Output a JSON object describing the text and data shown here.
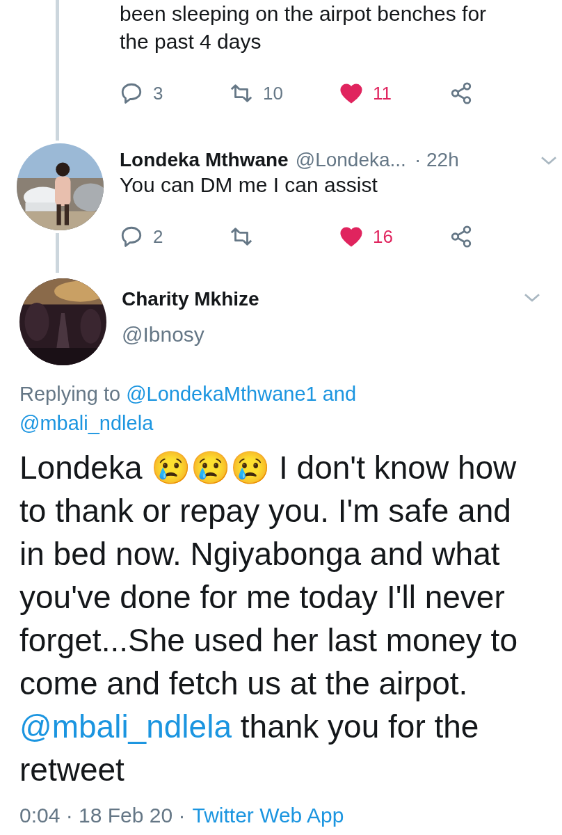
{
  "previous_tweet": {
    "text_lines": [
      "been sleeping on the airpot benches for",
      "the past 4 days"
    ],
    "actions": {
      "replies": "3",
      "retweets": "10",
      "likes": "11",
      "liked": true,
      "retweeted": false
    }
  },
  "reply_tweet": {
    "name": "Londeka Mthwane",
    "handle": "@Londeka...",
    "time": "· 22h",
    "text": "You can DM me I can assist",
    "actions": {
      "replies": "2",
      "likes": "16",
      "liked": true,
      "retweeted": false
    }
  },
  "main_tweet": {
    "name": "Charity Mkhize",
    "handle": "@Ibnosy",
    "replying": [
      {
        "kind": "text",
        "text": "Replying to"
      },
      {
        "kind": "mention",
        "text": "@LondekaMthwane1 and"
      },
      {
        "kind": "mention",
        "text": "@mbali_ndlela"
      }
    ],
    "body": [
      {
        "kind": "text",
        "text": "Londeka 😢😢😢 I don't know how to thank or repay you. I'm safe and in bed now. Ngiyabonga and what you've done for me today I'll never forget...She used her last money to come and fetch us at the airpot."
      },
      {
        "kind": "mention",
        "text": "@mbali_ndlela"
      },
      {
        "kind": "text",
        "text": "thank you for the retweet"
      }
    ],
    "timestamp": "0:04 · 18 Feb 20 ·",
    "source": "Twitter Web App"
  }
}
